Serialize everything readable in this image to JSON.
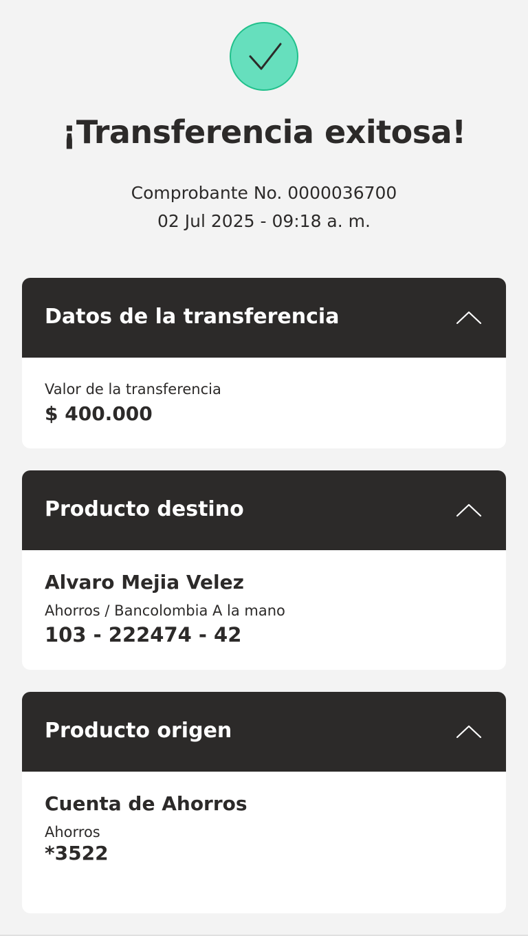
{
  "header": {
    "icon": "check-icon",
    "icon_color": "#66dfbd",
    "title": "¡Transferencia exitosa!",
    "receipt": "Comprobante No. 0000036700",
    "datetime": "02 Jul 2025 - 09:18 a. m."
  },
  "transfer_card": {
    "title": "Datos de la transferencia",
    "amount_label": "Valor de la transferencia",
    "amount_value": "$ 400.000"
  },
  "destination_card": {
    "title": "Producto destino",
    "name": "Alvaro Mejia Velez",
    "account_type": "Ahorros / Bancolombia A la mano",
    "account_number": "103 - 222474 - 42"
  },
  "origin_card": {
    "title": "Producto origen",
    "account_name": "Cuenta de Ahorros",
    "account_type": "Ahorros",
    "account_number": "*3522"
  },
  "colors": {
    "header_bg": "#2c2a29",
    "page_bg": "#f3f3f3",
    "success_green": "#66dfbd"
  }
}
